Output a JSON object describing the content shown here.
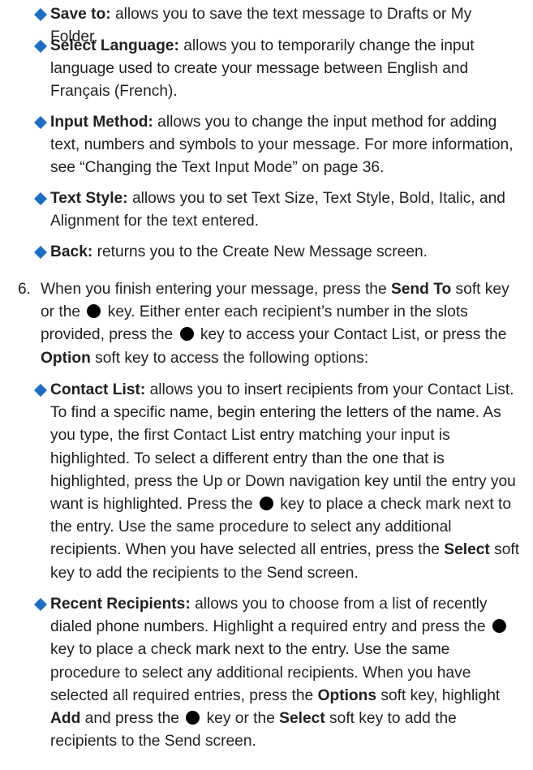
{
  "options_a": [
    {
      "term": "Save to:",
      "text": " allows you to save the text message to Drafts or My Folder."
    },
    {
      "term": "Select Language:",
      "text": " allows you to temporarily change the input language used to create your message between English and Français (French)."
    },
    {
      "term": "Input Method:",
      "text": " allows you to change the input method for adding text, numbers and symbols to your message. For more information, see “Changing the Text Input Mode” on page 36."
    },
    {
      "term": "Text Style:",
      "text": " allows you to set Text Size, Text Style, Bold, Italic, and Alignment for the text entered."
    },
    {
      "term": "Back:",
      "text": " returns you to the Create New Message screen."
    }
  ],
  "step6": {
    "number": "6.",
    "t1": "When you finish entering your message, press the ",
    "b1": "Send To",
    "t2": " soft key or the ",
    "t3": " key. Either enter each recipient’s number in the slots provided, press the ",
    "t4": " key to access your Contact List, or press the ",
    "b2": "Option",
    "t5": " soft key to access the following options:"
  },
  "contact_list": {
    "term": "Contact List:",
    "t1": " allows you to insert recipients from your Contact List. To find a specific name, begin entering the letters of the name. As you type, the first Contact List entry matching your input is highlighted. To select a different entry than the one that is highlighted, press the Up or Down navigation key until the entry you want is highlighted. Press the ",
    "t2": " key to place a check mark next to the entry. Use the same procedure to select any additional recipients. When you have selected all entries, press the ",
    "b1": "Select",
    "t3": " soft key to add the recipients to the Send screen."
  },
  "recent_recipients": {
    "term": "Recent Recipients:",
    "t1": " allows you to choose from a list of recently dialed phone numbers. Highlight a required entry and press the ",
    "t2": " key to place a check mark next to the entry. Use the same procedure to select any additional recipients. When you have selected all required entries, press the ",
    "b1": "Options",
    "t3": " soft key, highlight ",
    "b2": "Add",
    "t4": " and press the ",
    "t5": " key or the ",
    "b3": "Select",
    "t6": " soft key to add the recipients to the Send screen."
  },
  "colors": {
    "text": "#231f20",
    "bullet": "#1a6fc4",
    "key": "#000000"
  },
  "icons": {
    "bullet": "diamond-bullet-icon",
    "key": "ok-key-icon"
  }
}
